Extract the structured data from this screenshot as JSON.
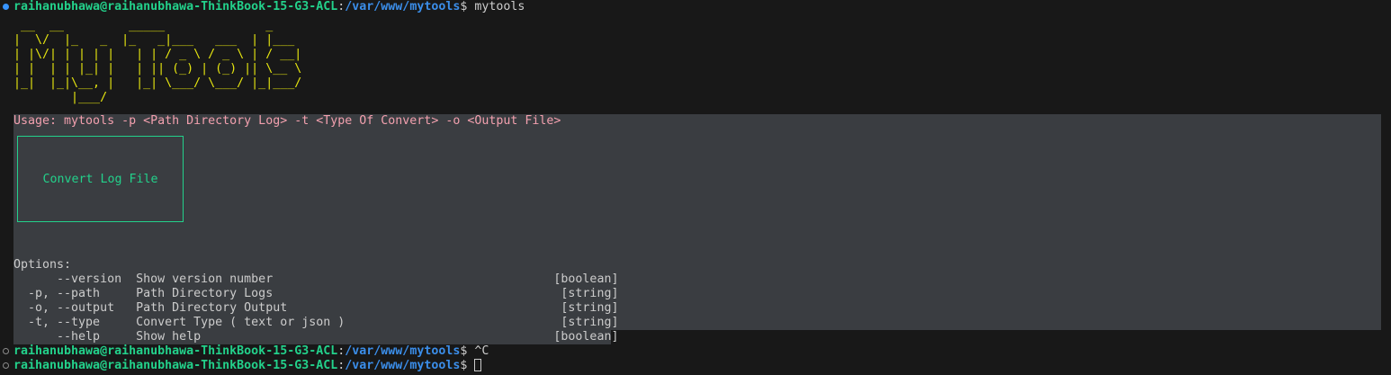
{
  "prompt": {
    "user_host": "raihanubhawa@raihanubhawa-ThinkBook-15-G3-ACL",
    "separator": ":",
    "cwd": "/var/www/mytools",
    "symbol": "$ "
  },
  "commands": {
    "first": "mytools",
    "interrupt": "^C"
  },
  "ascii_banner": " __  __         _____              _\n|  \\/  |_   _  |_   _|___   ___  | |___\n| |\\/| | | | |   | | / _ \\ / _ \\ | / __|\n| |  | | |_| |   | || (_) | (_) || \\__ \\\n|_|  |_|\\__, |   |_| \\___/ \\___/ |_|___/\n        |___/",
  "usage": "Usage: mytools -p <Path Directory Log> -t <Type Of Convert> -o <Output File>",
  "box_label": "Convert Log File",
  "options": {
    "header": "Options:",
    "lines": [
      "      --version  Show version number                                       [boolean]",
      "  -p, --path     Path Directory Logs                                        [string]",
      "  -o, --output   Path Directory Output                                      [string]",
      "  -t, --type     Convert Type ( text or json )                              [string]",
      "      --help     Show help                                                 [boolean]"
    ]
  },
  "colors": {
    "background": "#181818",
    "highlight_background": "#3a3d41",
    "user": "#23d18b",
    "path": "#3b8eea",
    "banner": "#e5e510",
    "usage": "#f2a0ae",
    "box": "#23d18b",
    "text": "#cccccc"
  }
}
